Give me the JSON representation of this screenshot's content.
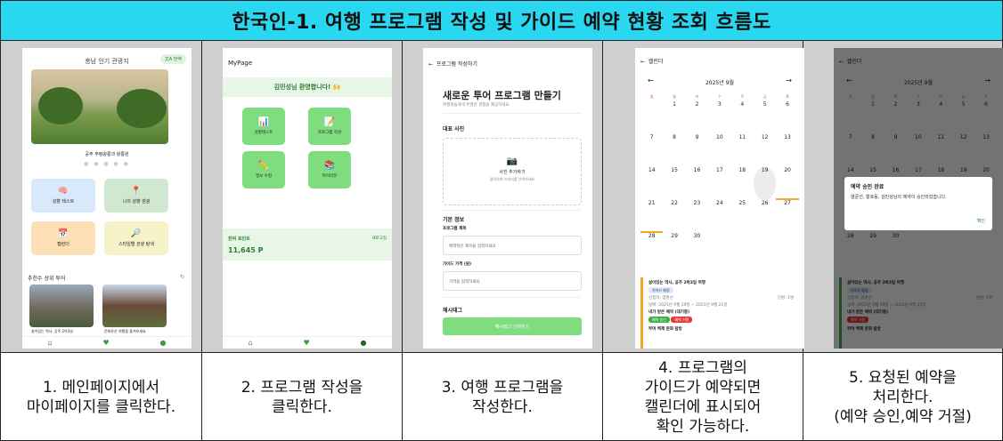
{
  "title": "한국인-1. 여행 프로그램 작성 및 가이드 예약 현황 조회 흐름도",
  "captions": [
    "1. 메인페이지에서\n마이페이지를 클릭한다.",
    "2. 프로그램 작성을\n클릭한다.",
    "3. 여행 프로그램을\n작성한다.",
    "4. 프로그램의\n가이드가 예약되면\n캘린더에 표시되어\n확인 가능하다.",
    "5. 요청된 예약을\n처리한다.\n(예약 승인,예약 거절)"
  ],
  "screen1": {
    "header": "충남 인기 관광지",
    "lang_button": "文A 번역",
    "photo_caption": "공주 무령왕릉과 왕릉원",
    "tiles": [
      "성향 테스트",
      "나의 성향 관광",
      "캘린더",
      "스타일별 관광 탐색"
    ],
    "recommend_title": "추천수 상위 투어",
    "thumb_captions": [
      "살아있는 역사, 공주 2박3일",
      "문화유산 여행을 즐겨보세요"
    ]
  },
  "screen2": {
    "top_title": "MyPage",
    "welcome": "김민성님 환영합니다! 🙌",
    "buttons": [
      "성향테스트",
      "프로그램 작성",
      "정보 수정",
      "마이리뷰"
    ],
    "points_label": "잔여 포인트",
    "points_refresh": "새로고침",
    "points_value": "11,645 P"
  },
  "screen3": {
    "top_title": "프로그램 작성하기",
    "heading": "새로운 투어 프로그램 만들기",
    "subheading": "여행객들에게 특별한 경험을 제공하세요",
    "photo_label": "대표 사진",
    "photo_add": "사진 추가하기",
    "photo_hint": "클릭하여 이미지를 선택하세요",
    "basic_info": "기본 정보",
    "name_label": "프로그램 제목",
    "name_placeholder": "매력적인 제목을 입력하세요",
    "price_label": "가이드 가격 (원)",
    "price_placeholder": "가격을 입력하세요",
    "hashtag_label": "해시태그",
    "hashtag_button": "해시태그 선택하기"
  },
  "calendar": {
    "top_title": "캘린더",
    "month": "2025년 9월",
    "weekdays": [
      "일",
      "월",
      "화",
      "수",
      "목",
      "금",
      "토"
    ],
    "weeks": [
      [
        "",
        "1",
        "2",
        "3",
        "4",
        "5",
        "6"
      ],
      [
        "7",
        "8",
        "9",
        "10",
        "11",
        "12",
        "13"
      ],
      [
        "14",
        "15",
        "16",
        "17",
        "18",
        "19",
        "20"
      ],
      [
        "21",
        "22",
        "23",
        "24",
        "25",
        "26",
        "27"
      ],
      [
        "28",
        "29",
        "30",
        "",
        "",
        "",
        ""
      ]
    ],
    "card_title": "살아있는 역사, 공주 2박3일 여행",
    "card_badge": "가이드 매칭",
    "card_guide": "신청자: 염준선",
    "card_people": "인원: 1명",
    "card_dates": "날짜: 2025년 9월 19일 ~ 2025년 9월 21일",
    "card_request": "내가 받은 예약 (대기중)",
    "approve": "예약 승인",
    "reject": "예약 거절",
    "next_title": "부여 백제 문화 탐방"
  },
  "dialog": {
    "title": "예약 승인 완료",
    "message": "염준선, 황호동, 김민성님의 예약이 승인되었습니다.",
    "confirm": "확인"
  },
  "colors": {
    "title_bar": "#29d8f0",
    "green": "#7fdd7f",
    "panel_bg": "#cfcfcf"
  }
}
